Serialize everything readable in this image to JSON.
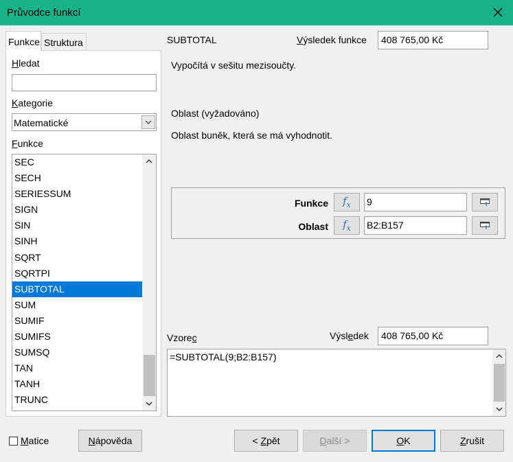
{
  "window": {
    "title": "Průvodce funkcí"
  },
  "tabs": [
    {
      "label": "Funkce"
    },
    {
      "label": "Struktura"
    }
  ],
  "left": {
    "search_label_accel": "H",
    "search_label_rest": "ledat",
    "search_value": "",
    "category_label_accel": "K",
    "category_label_rest": "ategorie",
    "category_value": "Matematické",
    "functions_label_accel": "F",
    "functions_label_rest": "unkce",
    "functions": [
      "SEC",
      "SECH",
      "SERIESSUM",
      "SIGN",
      "SIN",
      "SINH",
      "SQRT",
      "SQRTPI",
      "SUBTOTAL",
      "SUM",
      "SUMIF",
      "SUMIFS",
      "SUMSQ",
      "TAN",
      "TANH",
      "TRUNC"
    ],
    "selected_function": "SUBTOTAL"
  },
  "right": {
    "function_name": "SUBTOTAL",
    "result_label_accel": "V",
    "result_label_rest": "ýsledek funkce",
    "result_value": "408 765,00 Kč",
    "function_description": "Vypočítá v sešitu mezisoučty.",
    "parameter_name": "Oblast (vyžadováno)",
    "parameter_description": "Oblast buněk, která se má vyhodnotit.",
    "arguments": [
      {
        "label": "Funkce",
        "value": "9"
      },
      {
        "label": "Oblast",
        "value": "B2:B157"
      }
    ],
    "fx_symbol": "f",
    "fx_sub": "x",
    "formula_label_rest": "Vzore",
    "formula_label_accel": "c",
    "result2_label_pre": "Výsl",
    "result2_label_accel": "e",
    "result2_label_rest": "dek",
    "result2_value": "408 765,00 Kč",
    "formula": "=SUBTOTAL(9;B2:B157)"
  },
  "footer": {
    "matice_accel": "M",
    "matice_rest": "atice",
    "help_accel": "N",
    "help_rest": "ápověda",
    "back_pre": "< ",
    "back_accel": "Z",
    "back_rest": "pět",
    "next_accel": "D",
    "next_rest": "alší >",
    "ok_accel": "O",
    "ok_rest": "K",
    "cancel_accel": "Z",
    "cancel_rest": "rušit"
  },
  "icons": {
    "close": "close-icon",
    "dropdown": "chevron-down-icon",
    "fx": "function-icon",
    "shrink": "shrink-icon"
  },
  "colors": {
    "titlebar": "#18b38a",
    "selection": "#0078d7",
    "fx_text": "#2f74b5"
  }
}
